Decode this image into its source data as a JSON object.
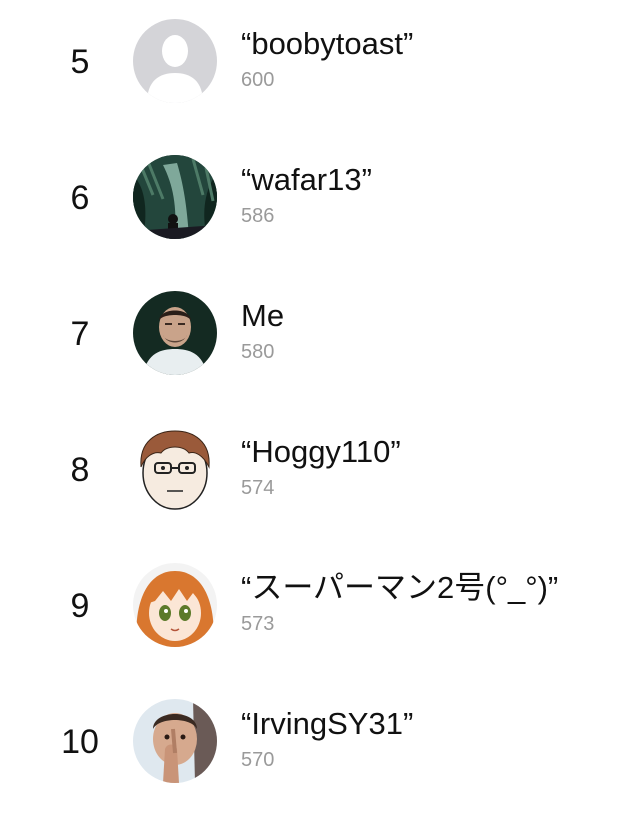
{
  "leaderboard": {
    "rows": [
      {
        "rank": "5",
        "name": "“boobytoast”",
        "score": "600",
        "avatar": "default-silhouette-icon"
      },
      {
        "rank": "6",
        "name": "“wafar13”",
        "score": "586",
        "avatar": "forest-photo-avatar"
      },
      {
        "rank": "7",
        "name": "Me",
        "score": "580",
        "avatar": "man-photo-avatar"
      },
      {
        "rank": "8",
        "name": "“Hoggy110”",
        "score": "574",
        "avatar": "glasses-cartoon-avatar"
      },
      {
        "rank": "9",
        "name": "“スーパーマン2号(°_°)”",
        "score": "573",
        "avatar": "anime-girl-avatar"
      },
      {
        "rank": "10",
        "name": "“IrvingSY31”",
        "score": "570",
        "avatar": "man-hand-photo-avatar"
      }
    ]
  }
}
